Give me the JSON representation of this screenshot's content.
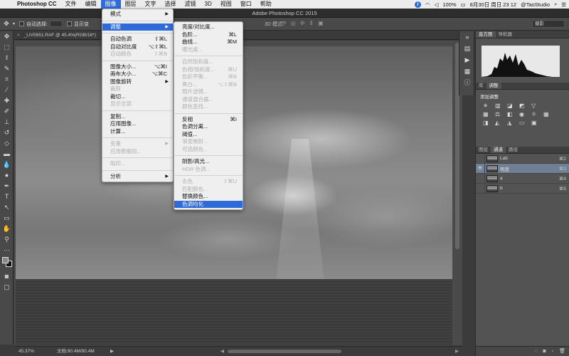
{
  "menubar": {
    "app": "Photoshop CC",
    "items": [
      "文件",
      "编辑",
      "图像",
      "图层",
      "文字",
      "选择",
      "滤镜",
      "3D",
      "视图",
      "窗口",
      "帮助"
    ],
    "active_index": 2,
    "battery": "100%",
    "datetime": "8月30日 周日  23 12",
    "user": "@TaoStudio"
  },
  "titlebar": {
    "title": "Adobe Photoshop CC 2015"
  },
  "options": {
    "auto_select_label": "自动选择:",
    "show_transform_label": "显示变",
    "mode3d_label": "3D 模式:",
    "workspace": "摄影"
  },
  "document": {
    "tab_title": "_LIV5651.RAF @ 45.4%(RGB/16*)",
    "zoom": "45.37%",
    "doc_size": "文档:90.4M/90.4M"
  },
  "image_menu": [
    {
      "label": "模式",
      "submenu": true
    },
    {
      "sep": true
    },
    {
      "label": "调整",
      "submenu": true,
      "highlight": true
    },
    {
      "sep": true
    },
    {
      "label": "自动色调",
      "shortcut": "⇧⌘L"
    },
    {
      "label": "自动对比度",
      "shortcut": "⌥⇧⌘L"
    },
    {
      "label": "自动颜色",
      "shortcut": "⇧⌘B",
      "disabled": true
    },
    {
      "sep": true
    },
    {
      "label": "图像大小...",
      "shortcut": "⌥⌘I"
    },
    {
      "label": "画布大小...",
      "shortcut": "⌥⌘C"
    },
    {
      "label": "图像旋转",
      "submenu": true
    },
    {
      "label": "裁剪",
      "disabled": true
    },
    {
      "label": "裁切..."
    },
    {
      "label": "显示全部",
      "disabled": true
    },
    {
      "sep": true
    },
    {
      "label": "复制..."
    },
    {
      "label": "应用图像..."
    },
    {
      "label": "计算..."
    },
    {
      "sep": true
    },
    {
      "label": "变量",
      "submenu": true,
      "disabled": true
    },
    {
      "label": "应用数据组...",
      "disabled": true
    },
    {
      "sep": true
    },
    {
      "label": "陷印...",
      "disabled": true
    },
    {
      "sep": true
    },
    {
      "label": "分析",
      "submenu": true
    }
  ],
  "adjust_menu": [
    {
      "label": "亮度/对比度..."
    },
    {
      "label": "色阶...",
      "shortcut": "⌘L"
    },
    {
      "label": "曲线...",
      "shortcut": "⌘M"
    },
    {
      "label": "曝光度...",
      "disabled": true
    },
    {
      "sep": true
    },
    {
      "label": "自然饱和度...",
      "disabled": true
    },
    {
      "label": "色相/饱和度...",
      "shortcut": "⌘U",
      "disabled": true
    },
    {
      "label": "色彩平衡...",
      "shortcut": "⌘B",
      "disabled": true
    },
    {
      "label": "黑白...",
      "shortcut": "⌥⇧⌘B",
      "disabled": true
    },
    {
      "label": "照片滤镜...",
      "disabled": true
    },
    {
      "label": "通道混合器...",
      "disabled": true
    },
    {
      "label": "颜色查找...",
      "disabled": true
    },
    {
      "sep": true
    },
    {
      "label": "反相",
      "shortcut": "⌘I"
    },
    {
      "label": "色调分离..."
    },
    {
      "label": "阈值..."
    },
    {
      "label": "渐变映射...",
      "disabled": true
    },
    {
      "label": "可选颜色...",
      "disabled": true
    },
    {
      "sep": true
    },
    {
      "label": "阴影/高光..."
    },
    {
      "label": "HDR 色调...",
      "disabled": true
    },
    {
      "sep": true
    },
    {
      "label": "去色",
      "shortcut": "⇧⌘U",
      "disabled": true
    },
    {
      "label": "匹配颜色...",
      "disabled": true
    },
    {
      "label": "替换颜色..."
    },
    {
      "label": "色调均化",
      "highlight": true
    }
  ],
  "panels": {
    "histogram_tabs": [
      "直方图",
      "导航器"
    ],
    "adjust_tabs": [
      "库",
      "调整"
    ],
    "adjust_title": "添加调整",
    "layers_tabs": [
      "图层",
      "通道",
      "路径"
    ],
    "channels": [
      {
        "name": "Lab",
        "shortcut": "⌘2",
        "visible": false,
        "selected": false
      },
      {
        "name": "明度",
        "shortcut": "⌘3",
        "visible": true,
        "selected": true
      },
      {
        "name": "a",
        "shortcut": "⌘4",
        "visible": false,
        "selected": false
      },
      {
        "name": "b",
        "shortcut": "⌘5",
        "visible": false,
        "selected": false
      }
    ]
  },
  "colors": {
    "accent": "#2f6bd8",
    "selected_channel": "#6f7f96"
  }
}
